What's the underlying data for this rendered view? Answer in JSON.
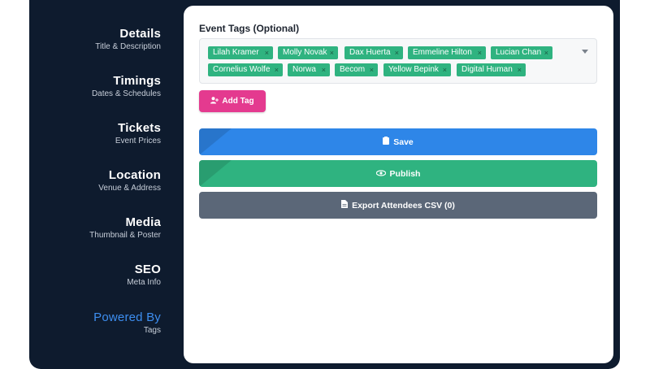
{
  "sidebar": {
    "items": [
      {
        "title": "Details",
        "subtitle": "Title & Description"
      },
      {
        "title": "Timings",
        "subtitle": "Dates & Schedules"
      },
      {
        "title": "Tickets",
        "subtitle": "Event Prices"
      },
      {
        "title": "Location",
        "subtitle": "Venue & Address"
      },
      {
        "title": "Media",
        "subtitle": "Thumbnail & Poster"
      },
      {
        "title": "SEO",
        "subtitle": "Meta Info"
      },
      {
        "title": "Powered By",
        "subtitle": "Tags"
      }
    ],
    "active_index": 6
  },
  "form": {
    "tags_label": "Event Tags (Optional)",
    "tags": [
      "Lilah Kramer",
      "Molly Novak",
      "Dax Huerta",
      "Emmeline Hilton",
      "Lucian Chan",
      "Cornelius Wolfe",
      "Norwa",
      "Becom",
      "Yellow Bepink",
      "Digital Human"
    ],
    "tag_remove_glyph": "×",
    "add_tag_label": "Add Tag"
  },
  "actions": {
    "save_label": "Save",
    "publish_label": "Publish",
    "export_label": "Export Attendees CSV (0)"
  },
  "colors": {
    "sidebar_bg": "#0e1b2e",
    "active_nav": "#3d8ef0",
    "tag_green": "#2fb380",
    "add_tag_pink": "#e43a8f",
    "save_blue": "#2e86e8",
    "publish_green": "#2fb380",
    "export_gray": "#5b6778"
  }
}
